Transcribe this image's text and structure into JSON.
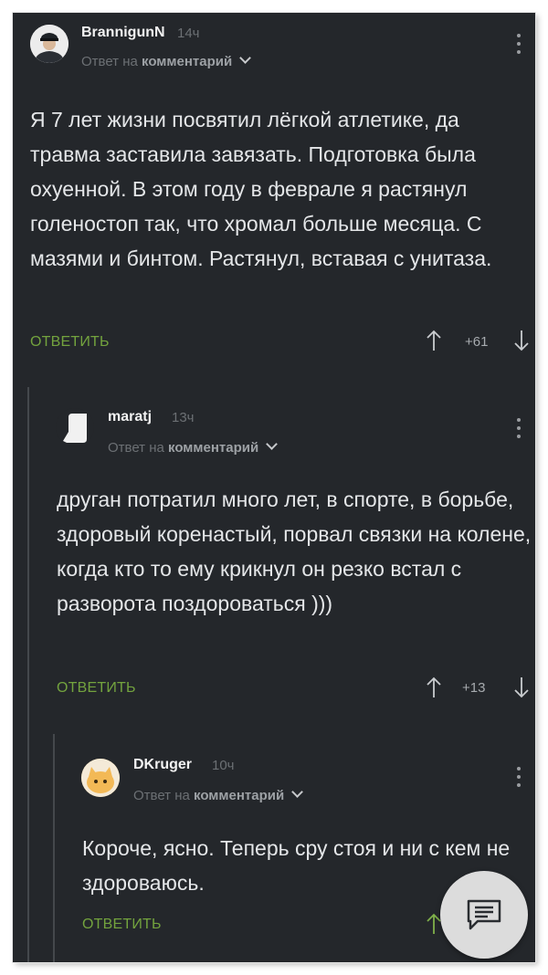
{
  "reply_label": "Ответ на",
  "reply_target": "комментарий",
  "comments": [
    {
      "username": "BrannigunN",
      "time": "14ч",
      "text": "Я 7 лет жизни посвятил лёгкой атлетике, да травма заставила завязать. Подготовка была охуенной. В этом году в феврале я растянул голеностоп так, что хромал больше месяца. С мазями и бинтом. Растянул, вставая с унитаза.",
      "reply": "ОТВЕТИТЬ",
      "score": "+61"
    },
    {
      "username": "maratj",
      "time": "13ч",
      "text": "друган потратил много лет, в спорте, в борьбе, здоровый коренастый, порвал связки на колене, когда кто то ему крикнул он резко встал с разворота поздороваться )))",
      "reply": "ОТВЕТИТЬ",
      "score": "+13"
    },
    {
      "username": "DKruger",
      "time": "10ч",
      "text": "Короче, ясно. Теперь сру стоя и ни с кем не здороваюсь.",
      "reply": "ОТВЕТИТЬ",
      "score": ""
    }
  ],
  "fab_icon": "comment-icon"
}
